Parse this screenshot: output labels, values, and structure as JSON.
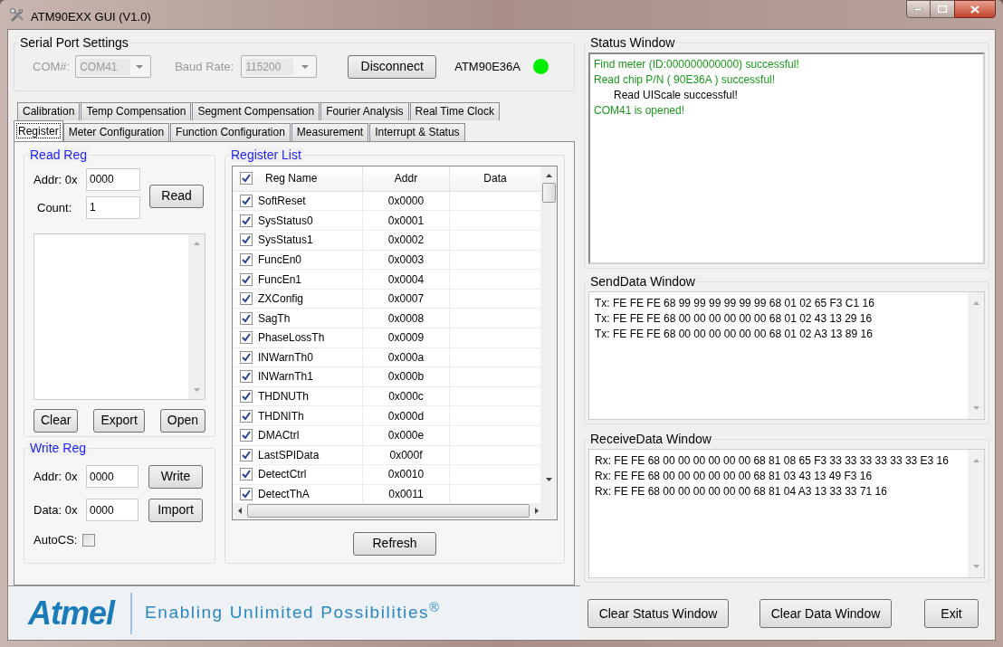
{
  "window": {
    "title": "ATM90EXX GUI (V1.0)"
  },
  "serial_port": {
    "title": "Serial Port Settings",
    "com_label": "COM#:",
    "com_value": "COM41",
    "baud_label": "Baud Rate:",
    "baud_value": "115200",
    "disabled": true,
    "button": "Disconnect",
    "chip": "ATM90E36A",
    "connected": true
  },
  "tab_rows": [
    {
      "tabs": [
        {
          "label": "Calibration",
          "selected": false
        },
        {
          "label": "Temp Compensation",
          "selected": false
        },
        {
          "label": "Segment Compensation",
          "selected": false
        },
        {
          "label": "Fourier Analysis",
          "selected": false
        },
        {
          "label": "Real Time Clock",
          "selected": false
        }
      ]
    },
    {
      "tabs": [
        {
          "label": "Register",
          "selected": true
        },
        {
          "label": "Meter Configuration",
          "selected": false
        },
        {
          "label": "Function Configuration",
          "selected": false
        },
        {
          "label": "Measurement",
          "selected": false
        },
        {
          "label": "Interrupt & Status",
          "selected": false
        }
      ]
    }
  ],
  "read_reg": {
    "title": "Read Reg",
    "addr_label": "Addr: 0x",
    "addr_value": "0000",
    "count_label": "Count:",
    "count_value": "1",
    "read_button": "Read",
    "buttons": [
      "Clear",
      "Export",
      "Open"
    ]
  },
  "write_reg": {
    "title": "Write Reg",
    "addr_label": "Addr: 0x",
    "addr_value": "0000",
    "data_label": "Data: 0x",
    "data_value": "0000",
    "write_button": "Write",
    "import_button": "Import",
    "autocs_label": "AutoCS:",
    "autocs_checked": false
  },
  "register_list": {
    "title": "Register List",
    "all_checked": true,
    "columns": [
      "Reg Name",
      "Addr",
      "Data"
    ],
    "rows": [
      {
        "name": "SoftReset",
        "addr": "0x0000",
        "checked": true
      },
      {
        "name": "SysStatus0",
        "addr": "0x0001",
        "checked": true
      },
      {
        "name": "SysStatus1",
        "addr": "0x0002",
        "checked": true
      },
      {
        "name": "FuncEn0",
        "addr": "0x0003",
        "checked": true
      },
      {
        "name": "FuncEn1",
        "addr": "0x0004",
        "checked": true
      },
      {
        "name": "ZXConfig",
        "addr": "0x0007",
        "checked": true
      },
      {
        "name": "SagTh",
        "addr": "0x0008",
        "checked": true
      },
      {
        "name": "PhaseLossTh",
        "addr": "0x0009",
        "checked": true
      },
      {
        "name": "INWarnTh0",
        "addr": "0x000a",
        "checked": true
      },
      {
        "name": "INWarnTh1",
        "addr": "0x000b",
        "checked": true
      },
      {
        "name": "THDNUTh",
        "addr": "0x000c",
        "checked": true
      },
      {
        "name": "THDNITh",
        "addr": "0x000d",
        "checked": true
      },
      {
        "name": "DMACtrl",
        "addr": "0x000e",
        "checked": true
      },
      {
        "name": "LastSPIData",
        "addr": "0x000f",
        "checked": true
      },
      {
        "name": "DetectCtrl",
        "addr": "0x0010",
        "checked": true
      },
      {
        "name": "DetectThA",
        "addr": "0x0011",
        "checked": true
      }
    ],
    "refresh_button": "Refresh"
  },
  "footer": {
    "logo": "Atmel",
    "tagline": "Enabling Unlimited Possibilities$^{®}$"
  },
  "status_window": {
    "title": "Status Window",
    "lines": [
      {
        "text": "Find meter (ID:000000000000) successful!",
        "color": "#1a9a1a",
        "indented": false
      },
      {
        "text": "Read chip P/N ( 90E36A ) successful!",
        "color": "#1a9a1a",
        "indented": false
      },
      {
        "text": "Read UIScale successful!",
        "color": "#000000",
        "indented": true
      },
      {
        "text": "COM41 is opened!",
        "color": "#1a9a1a",
        "indented": false
      }
    ]
  },
  "send_window": {
    "title": "SendData Window",
    "lines": [
      "Tx: FE FE FE 68 99 99 99 99 99 99 68 01 02 65 F3 C1 16",
      "Tx: FE FE FE 68 00 00 00 00 00 00 68 01 02 43 13 29 16",
      "Tx: FE FE FE 68 00 00 00 00 00 00 68 01 02 A3 13 89 16"
    ]
  },
  "receive_window": {
    "title": "ReceiveData Window",
    "lines": [
      "Rx: FE FE 68 00 00 00 00 00 00 68 81 08 65 F3 33 33 33 33 33 33 E3 16",
      "Rx: FE FE 68 00 00 00 00 00 00 68 81 03 43 13 49 F3 16",
      "Rx: FE FE 68 00 00 00 00 00 00 68 81 04 A3 13 33 33 71 16"
    ]
  },
  "buttons": [
    "Clear Status Window",
    "Clear Data Window",
    "Exit"
  ]
}
